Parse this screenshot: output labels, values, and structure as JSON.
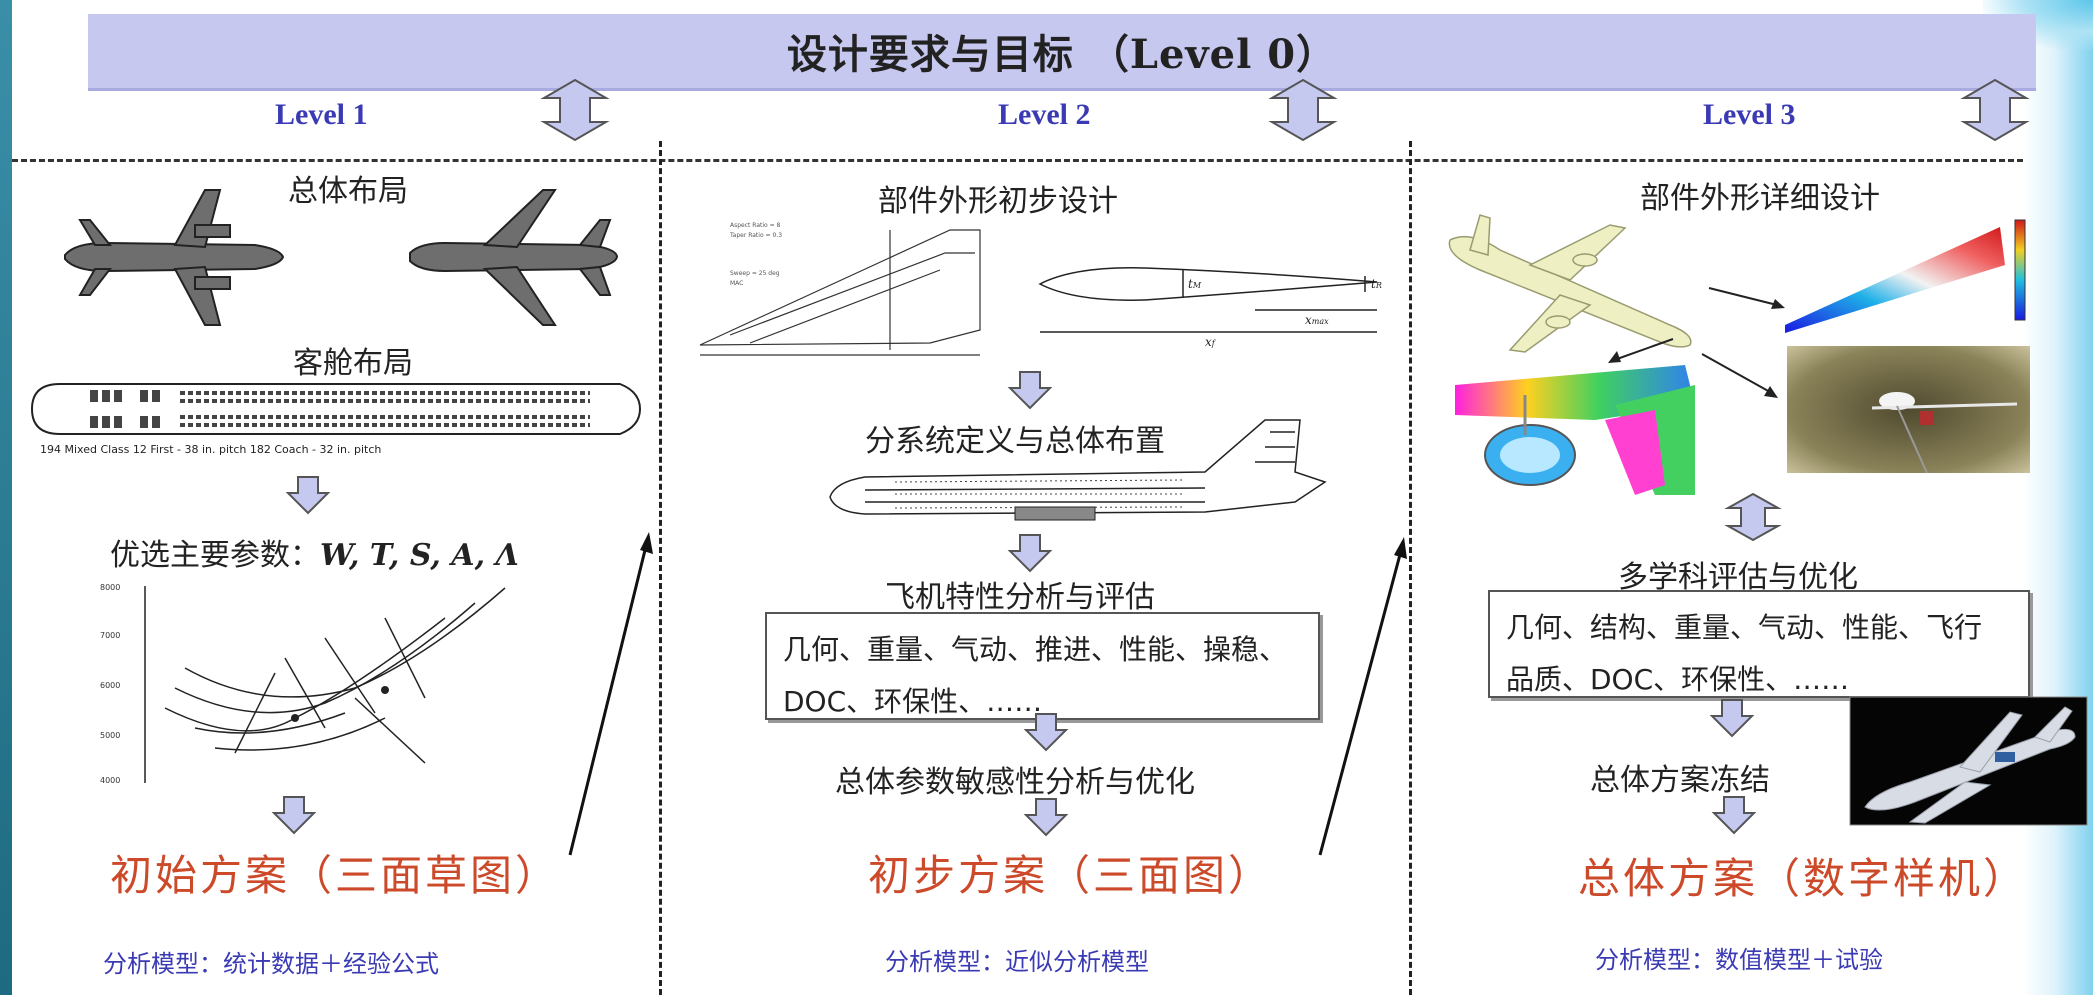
{
  "header": {
    "title": "设计要求与目标 （Level 0）"
  },
  "levels": [
    "Level 1",
    "Level 2",
    "Level 3"
  ],
  "col1": {
    "step1": "总体布局",
    "step2": "客舱布局",
    "cabin_caption": "194 Mixed Class    12 First - 38 in. pitch   182 Coach - 32 in. pitch",
    "step3_prefix": "优选主要参数：",
    "step3_params": "W, T, S, A, Λ",
    "result": "初始方案（三面草图）",
    "model": "分析模型：统计数据＋经验公式"
  },
  "col2": {
    "step1": "部件外形初步设计",
    "step2": "分系统定义与总体布置",
    "step3": "飞机特性分析与评估",
    "box_line1": "几何、重量、气动、推进、性能、操稳、",
    "box_line2": "DOC、环保性、……",
    "step4": "总体参数敏感性分析与优化",
    "result": "初步方案（三面图）",
    "model": "分析模型：近似分析模型"
  },
  "col3": {
    "step1": "部件外形详细设计",
    "step2": "多学科评估与优化",
    "box_line1": "几何、结构、重量、气动、性能、飞行",
    "box_line2": "品质、DOC、环保性、……",
    "step3": "总体方案冻结",
    "result": "总体方案（数字样机）",
    "model": "分析模型：数值模型＋试验"
  },
  "colors": {
    "title_bar": "#c7c8ef",
    "level_text": "#3a3ab5",
    "result_text": "#cc4a2a",
    "arrow_fill": "#c5c8ef"
  }
}
